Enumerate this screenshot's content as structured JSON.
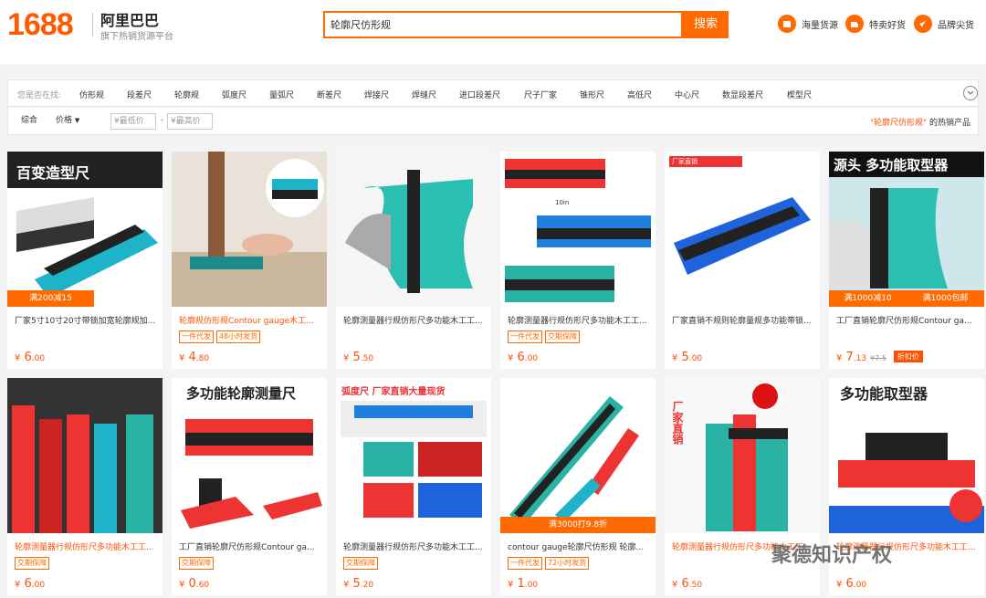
{
  "header": {
    "logo": "1688",
    "brand": "阿里巴巴",
    "brand_sub": "旗下热销货源平台",
    "search_value": "轮廓尺仿形规",
    "search_btn": "搜索",
    "nav": [
      {
        "label": "海量货源",
        "icon": "box-icon"
      },
      {
        "label": "特卖好货",
        "icon": "sale-icon"
      },
      {
        "label": "品牌尖货",
        "icon": "rocket-icon"
      }
    ]
  },
  "suggest": {
    "label": "您是否在找:",
    "items": [
      "仿形规",
      "段差尺",
      "轮廓规",
      "弧度尺",
      "量弧尺",
      "断差尺",
      "焊接尺",
      "焊缝尺",
      "进口段差尺",
      "尺子厂家",
      "锥形尺",
      "高低尺",
      "中心尺",
      "数显段差尺",
      "楔型尺"
    ]
  },
  "filter": {
    "sort": "综合",
    "price": "价格",
    "min_ph": "¥最低价",
    "max_ph": "¥最高价",
    "dash": "-",
    "hot_kw": "\"轮廓尺仿形规\"",
    "hot_suffix": "的热销产品"
  },
  "colors": {
    "accent": "#ff6a00",
    "price": "#ff5000"
  },
  "products": [
    {
      "title": "厂家5寸10寸20寸带锁加宽轮廓规加...",
      "tags": [],
      "cur": "¥",
      "int": "6",
      "dec": ".00",
      "promo": "满200减15",
      "img_text": "百变造型尺"
    },
    {
      "title": "轮廓规仿形规Contour gauge木工...",
      "tags": [
        "一件代发",
        "48小时发货"
      ],
      "cur": "¥",
      "int": "4",
      "dec": ".80",
      "promo": "",
      "img_text": ""
    },
    {
      "title": "轮廓测量器行规仿形尺多功能木工工...",
      "tags": [],
      "cur": "¥",
      "int": "5",
      "dec": ".50",
      "promo": "",
      "img_text": ""
    },
    {
      "title": "轮廓测量器行规仿形尺多功能木工工...",
      "tags": [
        "一件代发",
        "交期保障"
      ],
      "cur": "¥",
      "int": "6",
      "dec": ".00",
      "promo": "",
      "img_text": "10in"
    },
    {
      "title": "厂家直销不规则轮廓量规多功能带锁...",
      "tags": [],
      "cur": "¥",
      "int": "5",
      "dec": ".00",
      "promo": "",
      "img_text": "厂家直销"
    },
    {
      "title": "工厂直销轮廓尺仿形规Contour ga...",
      "tags": [],
      "cur": "¥",
      "int": "7",
      "dec": ".13",
      "old": "¥7.5",
      "disc": "折扣价",
      "promo": "满1000减10",
      "promo2": "满1000包邮",
      "img_text": "源头 多功能取型器"
    },
    {
      "title": "轮廓测量器行规仿形尺多功能木工工...",
      "tags": [
        "交期保障"
      ],
      "cur": "¥",
      "int": "6",
      "dec": ".00",
      "promo": "",
      "img_text": ""
    },
    {
      "title": "工厂直销轮廓尺仿形规Contour ga...",
      "tags": [
        "交期保障"
      ],
      "cur": "¥",
      "int": "0",
      "dec": ".60",
      "promo": "",
      "img_text": "多功能轮廓测量尺"
    },
    {
      "title": "轮廓测量器行规仿形尺多功能木工工...",
      "tags": [
        "交期保障"
      ],
      "cur": "¥",
      "int": "5",
      "dec": ".20",
      "promo": "",
      "img_text": "弧度尺 厂家直销大量现货"
    },
    {
      "title": "contour gauge轮廓尺仿形规 轮廓...",
      "tags": [
        "一件代发",
        "72小时发货"
      ],
      "cur": "¥",
      "int": "1",
      "dec": ".00",
      "promo": "满3000打9.8折",
      "img_text": ""
    },
    {
      "title": "轮廓测量器行规仿形尺多功能木工工...",
      "tags": [],
      "cur": "¥",
      "int": "6",
      "dec": ".50",
      "promo": "",
      "img_text": "厂家直销"
    },
    {
      "title": "轮廓测量器行规仿形尺多功能木工工...",
      "tags": [],
      "cur": "¥",
      "int": "6",
      "dec": ".00",
      "promo": "",
      "img_text": "多功能取型器"
    }
  ],
  "watermark": "聚德知识产权"
}
